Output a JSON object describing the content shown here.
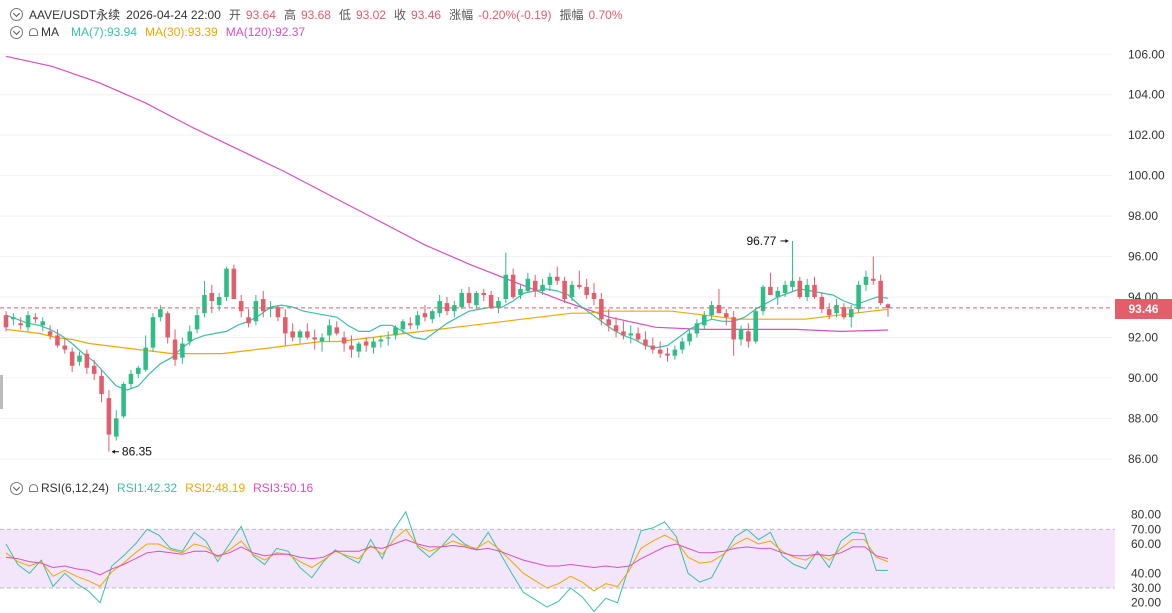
{
  "header": {
    "symbol": "AAVE/USDT永续",
    "datetime": "2026-04-24 22:00",
    "open_label": "开",
    "open_value": "93.64",
    "high_label": "高",
    "high_value": "93.68",
    "low_label": "低",
    "low_value": "93.02",
    "close_label": "收",
    "close_value": "93.46",
    "change_label": "涨幅",
    "change_value": "-0.20%(-0.19)",
    "amplitude_label": "振幅",
    "amplitude_value": "0.70%"
  },
  "ma_legend": {
    "label": "MA",
    "items": [
      {
        "label": "MA(7):93.94",
        "color": "#3bbfa8"
      },
      {
        "label": "MA(30):93.39",
        "color": "#f0a800"
      },
      {
        "label": "MA(120):92.37",
        "color": "#d94fc5"
      }
    ]
  },
  "rsi_legend": {
    "label": "RSI(6,12,24)",
    "items": [
      {
        "label": "RSI1:42.32",
        "color": "#3bbfa8"
      },
      {
        "label": "RSI2:48.19",
        "color": "#f0a800"
      },
      {
        "label": "RSI3:50.16",
        "color": "#d94fc5"
      }
    ]
  },
  "colors": {
    "up": "#2ebd85",
    "down": "#e35d6a",
    "rsi_band": "#f3e6fb"
  },
  "chart_data": [
    {
      "type": "candlestick",
      "title": "",
      "ylim": [
        85.2,
        107.2
      ],
      "yticks": [
        "106.00",
        "104.00",
        "102.00",
        "100.00",
        "98.00",
        "96.00",
        "94.00",
        "92.00",
        "90.00",
        "88.00",
        "86.00"
      ],
      "last_price": "93.46",
      "annotations": [
        {
          "text": "96.77",
          "value": 96.77,
          "type": "high"
        },
        {
          "text": "86.35",
          "value": 86.35,
          "type": "low"
        }
      ],
      "candles": [
        [
          93.1,
          93.3,
          92.3,
          92.5
        ],
        [
          92.9,
          93.2,
          92.6,
          93.0
        ],
        [
          92.7,
          93.0,
          92.4,
          92.6
        ],
        [
          92.5,
          93.3,
          92.3,
          93.1
        ],
        [
          93.0,
          93.2,
          92.7,
          92.9
        ],
        [
          92.6,
          93.0,
          92.3,
          92.8
        ],
        [
          92.3,
          92.6,
          91.9,
          92.1
        ],
        [
          92.1,
          92.4,
          91.5,
          91.6
        ],
        [
          91.6,
          92.0,
          91.2,
          91.4
        ],
        [
          91.3,
          91.5,
          90.3,
          90.6
        ],
        [
          90.8,
          91.3,
          90.6,
          91.1
        ],
        [
          91.2,
          91.4,
          90.2,
          90.5
        ],
        [
          90.6,
          90.9,
          89.9,
          90.2
        ],
        [
          90.1,
          90.4,
          88.8,
          89.2
        ],
        [
          89.0,
          89.4,
          86.35,
          87.2
        ],
        [
          87.1,
          88.4,
          86.9,
          88.0
        ],
        [
          88.1,
          89.8,
          88.0,
          89.7
        ],
        [
          89.7,
          90.4,
          89.5,
          90.2
        ],
        [
          90.2,
          90.6,
          90.0,
          90.5
        ],
        [
          90.4,
          92.1,
          90.3,
          91.5
        ],
        [
          91.5,
          93.2,
          91.3,
          93.0
        ],
        [
          93.0,
          93.6,
          92.8,
          93.4
        ],
        [
          93.2,
          93.3,
          91.7,
          92.0
        ],
        [
          91.9,
          92.4,
          90.6,
          90.9
        ],
        [
          91.0,
          92.0,
          90.7,
          91.7
        ],
        [
          91.8,
          92.6,
          91.6,
          92.3
        ],
        [
          92.4,
          93.4,
          92.2,
          93.1
        ],
        [
          93.2,
          94.8,
          93.0,
          94.1
        ],
        [
          94.2,
          94.6,
          93.2,
          93.8
        ],
        [
          93.6,
          94.2,
          93.3,
          94.0
        ],
        [
          94.0,
          95.5,
          93.8,
          95.4
        ],
        [
          95.4,
          95.6,
          93.9,
          93.9
        ],
        [
          93.8,
          94.1,
          93.0,
          93.3
        ],
        [
          93.0,
          93.4,
          92.5,
          92.7
        ],
        [
          92.8,
          94.1,
          92.6,
          93.8
        ],
        [
          93.9,
          94.3,
          93.0,
          93.3
        ],
        [
          93.4,
          93.8,
          93.0,
          93.5
        ],
        [
          93.5,
          93.6,
          92.8,
          93.0
        ],
        [
          93.0,
          93.4,
          91.6,
          92.2
        ],
        [
          92.3,
          92.7,
          91.8,
          92.0
        ],
        [
          92.0,
          92.4,
          91.7,
          92.3
        ],
        [
          92.3,
          92.7,
          91.9,
          92.0
        ],
        [
          92.0,
          92.4,
          91.4,
          91.9
        ],
        [
          91.8,
          92.2,
          91.3,
          92.0
        ],
        [
          92.1,
          92.9,
          91.8,
          92.6
        ],
        [
          92.5,
          92.8,
          92.1,
          92.2
        ],
        [
          92.0,
          92.3,
          91.3,
          91.7
        ],
        [
          91.6,
          92.1,
          91.0,
          91.4
        ],
        [
          91.3,
          91.8,
          91.0,
          91.7
        ],
        [
          91.8,
          92.0,
          91.3,
          91.6
        ],
        [
          91.5,
          92.0,
          91.2,
          91.8
        ],
        [
          91.8,
          92.1,
          91.5,
          91.9
        ],
        [
          92.0,
          92.3,
          91.6,
          92.0
        ],
        [
          92.1,
          92.6,
          91.9,
          92.5
        ],
        [
          92.4,
          92.9,
          92.2,
          92.8
        ],
        [
          92.7,
          93.0,
          92.4,
          92.6
        ],
        [
          92.6,
          93.3,
          92.4,
          93.1
        ],
        [
          93.2,
          93.6,
          92.8,
          93.0
        ],
        [
          92.9,
          93.4,
          92.7,
          93.3
        ],
        [
          93.2,
          94.1,
          93.0,
          93.8
        ],
        [
          93.7,
          94.0,
          93.1,
          93.3
        ],
        [
          93.3,
          93.8,
          93.0,
          93.6
        ],
        [
          93.5,
          94.4,
          93.4,
          94.2
        ],
        [
          94.2,
          94.5,
          93.5,
          93.7
        ],
        [
          93.6,
          94.3,
          93.4,
          94.2
        ],
        [
          94.2,
          94.4,
          93.8,
          94.1
        ],
        [
          94.1,
          94.3,
          93.4,
          93.5
        ],
        [
          93.5,
          94.0,
          93.2,
          93.8
        ],
        [
          93.9,
          96.2,
          93.7,
          95.1
        ],
        [
          95.1,
          95.4,
          93.9,
          94.0
        ],
        [
          94.1,
          94.6,
          93.9,
          94.4
        ],
        [
          94.3,
          95.2,
          94.2,
          94.9
        ],
        [
          94.8,
          95.1,
          94.0,
          94.3
        ],
        [
          94.3,
          94.9,
          94.1,
          94.6
        ],
        [
          94.6,
          95.2,
          94.3,
          95.0
        ],
        [
          95.0,
          95.5,
          94.6,
          94.8
        ],
        [
          94.8,
          95.0,
          93.7,
          93.9
        ],
        [
          94.0,
          94.8,
          93.8,
          94.6
        ],
        [
          94.6,
          95.3,
          94.4,
          94.5
        ],
        [
          94.5,
          94.9,
          93.9,
          94.1
        ],
        [
          94.2,
          94.7,
          93.6,
          93.9
        ],
        [
          93.9,
          94.2,
          92.6,
          92.9
        ],
        [
          92.9,
          93.4,
          92.3,
          92.6
        ],
        [
          92.6,
          93.0,
          92.0,
          92.3
        ],
        [
          92.3,
          92.8,
          91.9,
          92.1
        ],
        [
          92.1,
          92.6,
          91.7,
          92.2
        ],
        [
          92.2,
          92.5,
          91.8,
          91.9
        ],
        [
          91.9,
          92.3,
          91.4,
          91.6
        ],
        [
          91.6,
          92.0,
          91.2,
          91.4
        ],
        [
          91.4,
          91.8,
          91.0,
          91.2
        ],
        [
          91.2,
          91.5,
          90.8,
          91.1
        ],
        [
          91.1,
          91.6,
          90.9,
          91.4
        ],
        [
          91.4,
          92.0,
          91.2,
          91.8
        ],
        [
          91.8,
          92.4,
          91.6,
          92.2
        ],
        [
          92.2,
          92.9,
          92.0,
          92.7
        ],
        [
          92.6,
          93.3,
          92.4,
          93.1
        ],
        [
          93.1,
          93.8,
          92.9,
          93.6
        ],
        [
          93.6,
          94.4,
          93.3,
          93.2
        ],
        [
          93.2,
          93.4,
          92.6,
          93.0
        ],
        [
          93.0,
          93.3,
          91.1,
          91.9
        ],
        [
          91.9,
          92.6,
          91.6,
          92.4
        ],
        [
          92.3,
          92.7,
          91.5,
          91.8
        ],
        [
          91.8,
          93.5,
          91.7,
          93.3
        ],
        [
          93.3,
          94.6,
          93.1,
          94.5
        ],
        [
          94.5,
          95.2,
          94.1,
          94.1
        ],
        [
          94.0,
          94.5,
          93.6,
          94.3
        ],
        [
          94.2,
          94.8,
          94.0,
          94.6
        ],
        [
          94.5,
          96.77,
          94.3,
          94.8
        ],
        [
          94.8,
          95.0,
          93.9,
          94.0
        ],
        [
          94.0,
          94.9,
          93.8,
          94.6
        ],
        [
          94.6,
          95.0,
          93.9,
          94.0
        ],
        [
          94.0,
          94.2,
          93.2,
          93.4
        ],
        [
          93.4,
          93.7,
          92.9,
          93.1
        ],
        [
          93.2,
          93.9,
          93.0,
          93.6
        ],
        [
          93.5,
          93.7,
          92.9,
          93.0
        ],
        [
          93.0,
          93.6,
          92.5,
          93.4
        ],
        [
          93.4,
          94.8,
          93.2,
          94.6
        ],
        [
          94.6,
          95.3,
          94.3,
          95.0
        ],
        [
          94.9,
          96.0,
          94.6,
          94.8
        ],
        [
          94.8,
          95.1,
          93.6,
          93.7
        ],
        [
          93.64,
          93.68,
          93.02,
          93.46
        ]
      ],
      "ma7": [
        93.1,
        92.9,
        92.7,
        92.6,
        92.4,
        92.1,
        91.7,
        91.2,
        90.8,
        90.2,
        89.6,
        89.4,
        89.6,
        90.2,
        90.7,
        91.0,
        91.5,
        91.9,
        92.1,
        92.2,
        92.3,
        92.6,
        92.8,
        93.1,
        93.5,
        93.6,
        93.5,
        93.3,
        93.2,
        93.1,
        93.0,
        92.6,
        92.3,
        92.3,
        92.6,
        92.6,
        92.3,
        92.0,
        91.9,
        92.3,
        92.7,
        93.0,
        93.3,
        93.4,
        93.5,
        93.5,
        93.8,
        94.2,
        94.3,
        94.4,
        94.3,
        94.1,
        93.6,
        93.2,
        92.8,
        92.4,
        92.1,
        91.9,
        91.6,
        91.5,
        91.6,
        92.0,
        92.4,
        92.7,
        92.9,
        92.8,
        92.8,
        93.0,
        93.4,
        93.7,
        94.0,
        94.2,
        94.4,
        94.3,
        94.2,
        94.1,
        93.8,
        93.6,
        93.8,
        94.0,
        93.94
      ],
      "ma30": [
        92.4,
        92.3,
        92.2,
        92.0,
        91.9,
        91.7,
        91.6,
        91.5,
        91.4,
        91.3,
        91.2,
        91.2,
        91.2,
        91.2,
        91.3,
        91.4,
        91.5,
        91.6,
        91.7,
        91.8,
        91.8,
        91.9,
        92.0,
        92.1,
        92.2,
        92.3,
        92.4,
        92.5,
        92.6,
        92.7,
        92.8,
        92.9,
        93.0,
        93.1,
        93.2,
        93.2,
        93.3,
        93.3,
        93.3,
        93.3,
        93.3,
        93.2,
        93.1,
        93.0,
        92.9,
        92.9,
        92.9,
        92.9,
        92.9,
        93.0,
        93.1,
        93.2,
        93.3,
        93.39
      ],
      "ma120": [
        105.9,
        105.4,
        104.6,
        103.6,
        102.4,
        101.3,
        100.2,
        99.0,
        97.8,
        96.6,
        95.6,
        94.7,
        93.8,
        93.0,
        92.5,
        92.4,
        92.4,
        92.4,
        92.3,
        92.37
      ],
      "rsi": {
        "ylim": [
          15,
          90
        ],
        "yticks": [
          "80.00",
          "70.00",
          "60.00",
          "40.00",
          "30.00",
          "20.00"
        ],
        "band": [
          30,
          70
        ],
        "series": [
          {
            "name": "RSI1",
            "values": [
              60,
              46,
              40,
              49,
              31,
              40,
              33,
              28,
              20,
              45,
              52,
              60,
              70,
              66,
              57,
              55,
              68,
              62,
              48,
              60,
              72,
              52,
              46,
              57,
              55,
              44,
              37,
              48,
              56,
              51,
              47,
              63,
              50,
              70,
              82,
              58,
              51,
              58,
              67,
              60,
              56,
              68,
              54,
              40,
              27,
              22,
              17,
              21,
              30,
              24,
              14,
              23,
              20,
              45,
              69,
              71,
              75,
              65,
              40,
              34,
              37,
              52,
              65,
              70,
              63,
              68,
              52,
              46,
              43,
              55,
              44,
              62,
              68,
              67,
              42,
              42
            ]
          },
          {
            "name": "RSI2",
            "values": [
              54,
              48,
              45,
              48,
              38,
              42,
              38,
              35,
              31,
              41,
              47,
              54,
              60,
              60,
              56,
              54,
              60,
              58,
              51,
              56,
              62,
              53,
              49,
              54,
              53,
              48,
              44,
              49,
              55,
              52,
              50,
              59,
              53,
              63,
              70,
              59,
              55,
              58,
              62,
              59,
              57,
              62,
              56,
              48,
              40,
              35,
              30,
              33,
              38,
              34,
              28,
              33,
              31,
              42,
              57,
              62,
              66,
              62,
              51,
              47,
              48,
              53,
              60,
              64,
              60,
              62,
              55,
              51,
              49,
              54,
              49,
              57,
              63,
              63,
              51,
              48
            ]
          },
          {
            "name": "RSI3",
            "values": [
              51,
              50,
              48,
              47,
              44,
              45,
              43,
              42,
              39,
              43,
              46,
              50,
              54,
              55,
              54,
              53,
              55,
              55,
              52,
              54,
              58,
              54,
              52,
              53,
              53,
              51,
              50,
              51,
              55,
              55,
              55,
              58,
              57,
              60,
              63,
              60,
              58,
              58,
              59,
              58,
              56,
              57,
              55,
              52,
              49,
              47,
              45,
              45,
              46,
              45,
              44,
              45,
              44,
              45,
              50,
              54,
              58,
              60,
              57,
              54,
              54,
              55,
              57,
              58,
              57,
              57,
              54,
              52,
              52,
              53,
              52,
              54,
              58,
              58,
              52,
              50
            ]
          }
        ]
      }
    }
  ]
}
